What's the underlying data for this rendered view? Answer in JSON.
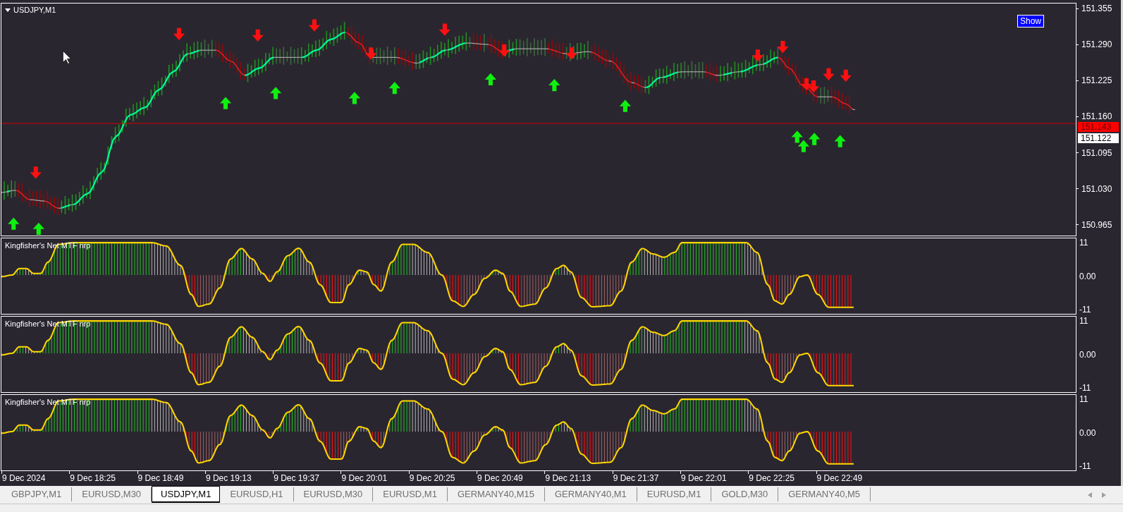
{
  "chart": {
    "title": "USDJPY,M1",
    "show_button": "Show",
    "price_axis": [
      "151.355",
      "151.290",
      "151.225",
      "151.160",
      "151.095",
      "151.030",
      "150.965"
    ],
    "bid_label": "151.143",
    "ask_label": "151.122"
  },
  "indicators": [
    {
      "title": "Kingfisher's Net MTF nrp",
      "axis": [
        "11",
        "0.00",
        "-11"
      ]
    },
    {
      "title": "Kingfisher's Net MTF nrp",
      "axis": [
        "11",
        "0.00",
        "-11"
      ]
    },
    {
      "title": "Kingfisher's Net MTF nrp",
      "axis": [
        "11",
        "0.00",
        "-11"
      ]
    }
  ],
  "time_axis": [
    "9 Dec 2024",
    "9 Dec 18:25",
    "9 Dec 18:49",
    "9 Dec 19:13",
    "9 Dec 19:37",
    "9 Dec 20:01",
    "9 Dec 20:25",
    "9 Dec 20:49",
    "9 Dec 21:13",
    "9 Dec 21:37",
    "9 Dec 22:01",
    "9 Dec 22:25",
    "9 Dec 22:49"
  ],
  "tabs": [
    {
      "label": "GBPJPY,M1",
      "selected": false
    },
    {
      "label": "EURUSD,M30",
      "selected": false
    },
    {
      "label": "USDJPY,M1",
      "selected": true
    },
    {
      "label": "EURUSD,H1",
      "selected": false
    },
    {
      "label": "EURUSD,M30",
      "selected": false
    },
    {
      "label": "EURUSD,M1",
      "selected": false
    },
    {
      "label": "GERMANY40,M15",
      "selected": false
    },
    {
      "label": "GERMANY40,M1",
      "selected": false
    },
    {
      "label": "EURUSD,M1",
      "selected": false
    },
    {
      "label": "GOLD,M30",
      "selected": false
    },
    {
      "label": "GERMANY40,M5",
      "selected": false
    }
  ]
}
